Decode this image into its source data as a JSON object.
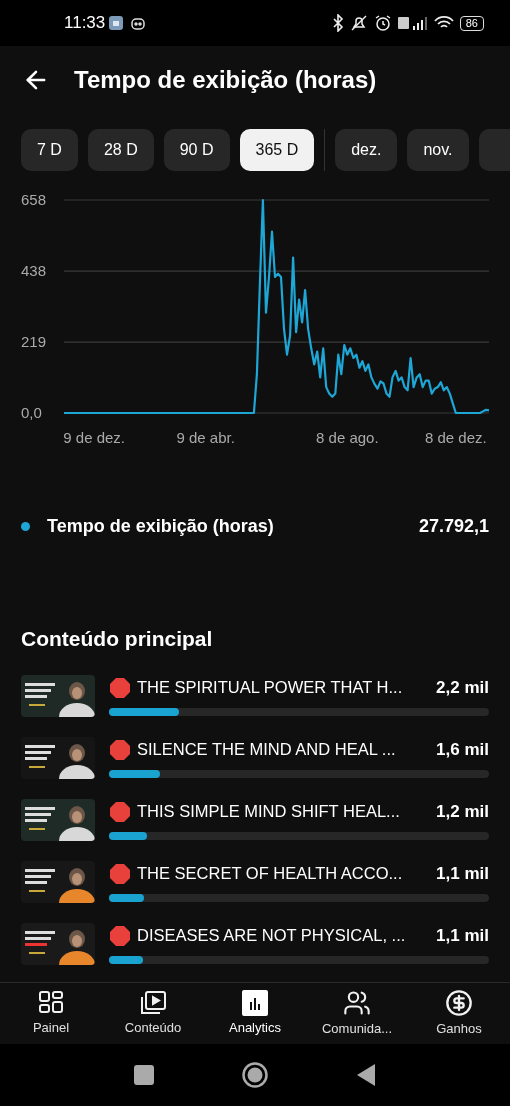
{
  "status_bar": {
    "time": "11:33",
    "battery": "86"
  },
  "header": {
    "title": "Tempo de exibição (horas)"
  },
  "range_chips": [
    {
      "label": "7 D",
      "selected": false
    },
    {
      "label": "28 D",
      "selected": false
    },
    {
      "label": "90 D",
      "selected": false
    },
    {
      "label": "365 D",
      "selected": true
    }
  ],
  "month_chips": [
    {
      "label": "dez.",
      "selected": false
    },
    {
      "label": "nov.",
      "selected": false
    }
  ],
  "chart": {
    "chart_data": {
      "type": "line",
      "categories": [
        null,
        null,
        null,
        null,
        null,
        null,
        null,
        null,
        null,
        null,
        "9 de dez.",
        null,
        null,
        null,
        null,
        null,
        null,
        null,
        null,
        null,
        null,
        null,
        null,
        null,
        null,
        null,
        null,
        null,
        null,
        null,
        null,
        null,
        null,
        null,
        null,
        null,
        null,
        null,
        null,
        null,
        null,
        null,
        null,
        null,
        null,
        null,
        null,
        "9 de abr.",
        null,
        null,
        null,
        null,
        null,
        null,
        null,
        null,
        null,
        null,
        null,
        null,
        null,
        null,
        null,
        null,
        null,
        null,
        null,
        null,
        null,
        null,
        null,
        null,
        null,
        null,
        null,
        null,
        null,
        null,
        null,
        null,
        null,
        null,
        null,
        null,
        null,
        null,
        null,
        null,
        null,
        null,
        null,
        null,
        null,
        null,
        "8 de ago.",
        null,
        null,
        null,
        null,
        null,
        null,
        null,
        null,
        null,
        null,
        null,
        null,
        null,
        null,
        null,
        null,
        null,
        null,
        null,
        null,
        null,
        null,
        null,
        null,
        null,
        null,
        null,
        null,
        null,
        null,
        null,
        null,
        null,
        null,
        null,
        "8 de dez.",
        null,
        null,
        null,
        null,
        null,
        null,
        null,
        null,
        null,
        null,
        null
      ],
      "series": [
        {
          "name": "Tempo de exibição (horas)",
          "color": "#1ea7d6",
          "values": [
            0,
            0,
            0,
            0,
            0,
            0,
            0,
            0,
            0,
            0,
            0,
            0,
            0,
            0,
            0,
            0,
            0,
            0,
            0,
            0,
            0,
            0,
            0,
            0,
            0,
            0,
            0,
            0,
            0,
            0,
            0,
            0,
            0,
            0,
            0,
            0,
            0,
            0,
            0,
            0,
            0,
            0,
            0,
            0,
            0,
            0,
            0,
            0,
            0,
            0,
            0,
            0,
            0,
            0,
            0,
            0,
            0,
            0,
            0,
            0,
            0,
            0,
            0,
            0,
            120,
            400,
            658,
            310,
            420,
            560,
            420,
            430,
            420,
            260,
            180,
            240,
            480,
            250,
            350,
            280,
            380,
            260,
            200,
            150,
            190,
            110,
            200,
            80,
            60,
            50,
            60,
            180,
            120,
            210,
            180,
            200,
            170,
            180,
            140,
            160,
            130,
            150,
            110,
            90,
            75,
            98,
            91,
            60,
            50,
            110,
            130,
            100,
            110,
            80,
            70,
            170,
            80,
            110,
            120,
            80,
            100,
            100,
            60,
            75,
            80,
            95,
            70,
            80,
            60,
            30,
            0,
            0,
            0,
            0,
            0,
            0,
            0,
            0,
            0,
            5,
            10,
            8
          ]
        }
      ],
      "ylim": [
        0,
        658
      ],
      "yticks": [
        {
          "value": 0,
          "label": "0,0"
        },
        {
          "value": 219,
          "label": "219"
        },
        {
          "value": 438,
          "label": "438"
        },
        {
          "value": 658,
          "label": "658"
        }
      ]
    }
  },
  "legend": {
    "total": "27.792,1"
  },
  "top_content": {
    "heading": "Conteúdo principal",
    "items": [
      {
        "title": "THE SPIRITUAL POWER THAT H...",
        "value": "2,2 mil",
        "level": 0.185
      },
      {
        "title": "SILENCE THE MIND AND HEAL ...",
        "value": "1,6 mil",
        "level": 0.135
      },
      {
        "title": "THIS SIMPLE MIND SHIFT HEAL...",
        "value": "1,2 mil",
        "level": 0.1
      },
      {
        "title": "THE SECRET OF HEALTH ACCO...",
        "value": "1,1 mil",
        "level": 0.093
      },
      {
        "title": "DISEASES ARE NOT PHYSICAL, ...",
        "value": "1,1 mil",
        "level": 0.09
      }
    ]
  },
  "bottom_nav": [
    {
      "label": "Painel",
      "kind": "dashboard",
      "selected": false
    },
    {
      "label": "Conteúdo",
      "kind": "content",
      "selected": false
    },
    {
      "label": "Analytics",
      "kind": "analytics",
      "selected": true
    },
    {
      "label": "Comunida...",
      "kind": "community",
      "selected": false
    },
    {
      "label": "Ganhos",
      "kind": "earnings",
      "selected": false
    }
  ]
}
